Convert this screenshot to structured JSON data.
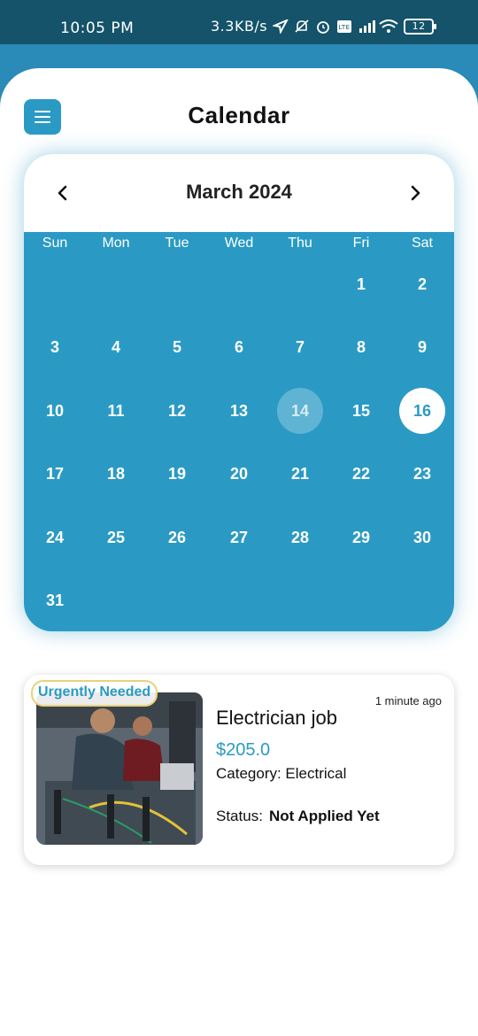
{
  "status_bar": {
    "time": "10:05 PM",
    "network_speed": "3.3KB/s",
    "battery": "12"
  },
  "header": {
    "title": "Calendar",
    "menu_icon": "hamburger-menu-icon"
  },
  "calendar": {
    "month_label": "March 2024",
    "prev_icon": "chevron-left-icon",
    "next_icon": "chevron-right-icon",
    "weekdays": [
      "Sun",
      "Mon",
      "Tue",
      "Wed",
      "Thu",
      "Fri",
      "Sat"
    ],
    "first_weekday_index": 5,
    "days_in_month": 31,
    "today": 14,
    "selected": 16
  },
  "job": {
    "badge": "Urgently Needed",
    "time_ago": "1 minute ago",
    "title": "Electrician job",
    "price": "$205.0",
    "category": "Category: Electrical",
    "status_label": "Status:",
    "status_value": "Not Applied Yet"
  },
  "colors": {
    "primary": "#2a9ac4",
    "status_bar": "#14536a",
    "badge_border": "#e8d27a"
  }
}
